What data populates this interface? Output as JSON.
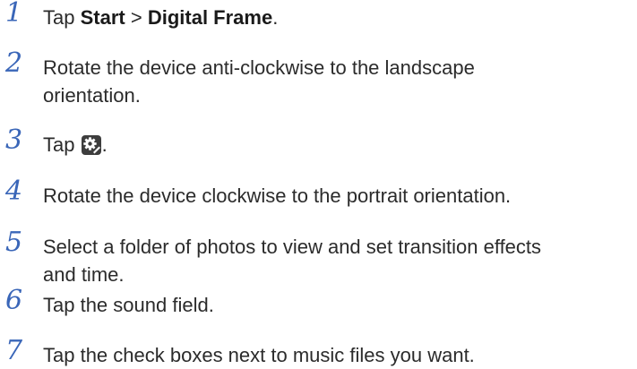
{
  "steps": [
    {
      "number": "1",
      "tap": "Tap",
      "start": "Start",
      "separator": ">",
      "app": "Digital Frame",
      "end": "."
    },
    {
      "number": "2",
      "line1": "Rotate the device anti-clockwise to the landscape",
      "line2": "orientation."
    },
    {
      "number": "3",
      "tap": "Tap",
      "icon": "settings-gear-icon",
      "end": "."
    },
    {
      "number": "4",
      "text": "Rotate the device clockwise to the portrait orientation."
    },
    {
      "number": "5",
      "line1": "Select a folder of photos to view and set transition effects",
      "line2": "and time."
    },
    {
      "number": "6",
      "text": "Tap the sound field."
    },
    {
      "number": "7",
      "text": "Tap the check boxes next to music files you want."
    }
  ],
  "colors": {
    "step_number": "#3a66b8",
    "body_text": "#2b2b2b",
    "icon_bg": "#3d3d3d"
  }
}
